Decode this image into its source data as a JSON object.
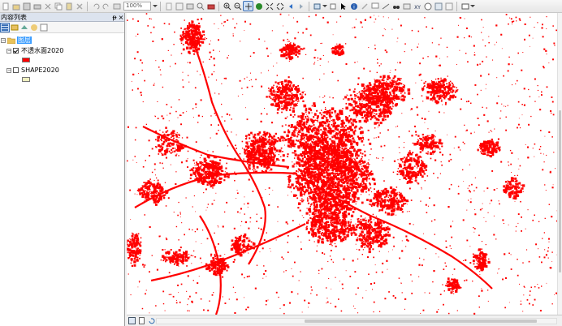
{
  "toolbar": {
    "zoom_value": "100%"
  },
  "toc": {
    "title": "内容列表",
    "pin_glyph": "ᵽ",
    "close_glyph": "×",
    "layers_group": {
      "label": "图层",
      "expander": "−"
    },
    "layers": [
      {
        "name": "不透水面2020",
        "checked": true,
        "expander": "−",
        "swatch_color": "#ff0000"
      },
      {
        "name": "SHAPE2020",
        "checked": false,
        "expander": "−",
        "swatch_color": "#f0f0c0"
      }
    ]
  },
  "map": {
    "feature_color": "#ff0000",
    "background_color": "#ffffff"
  }
}
